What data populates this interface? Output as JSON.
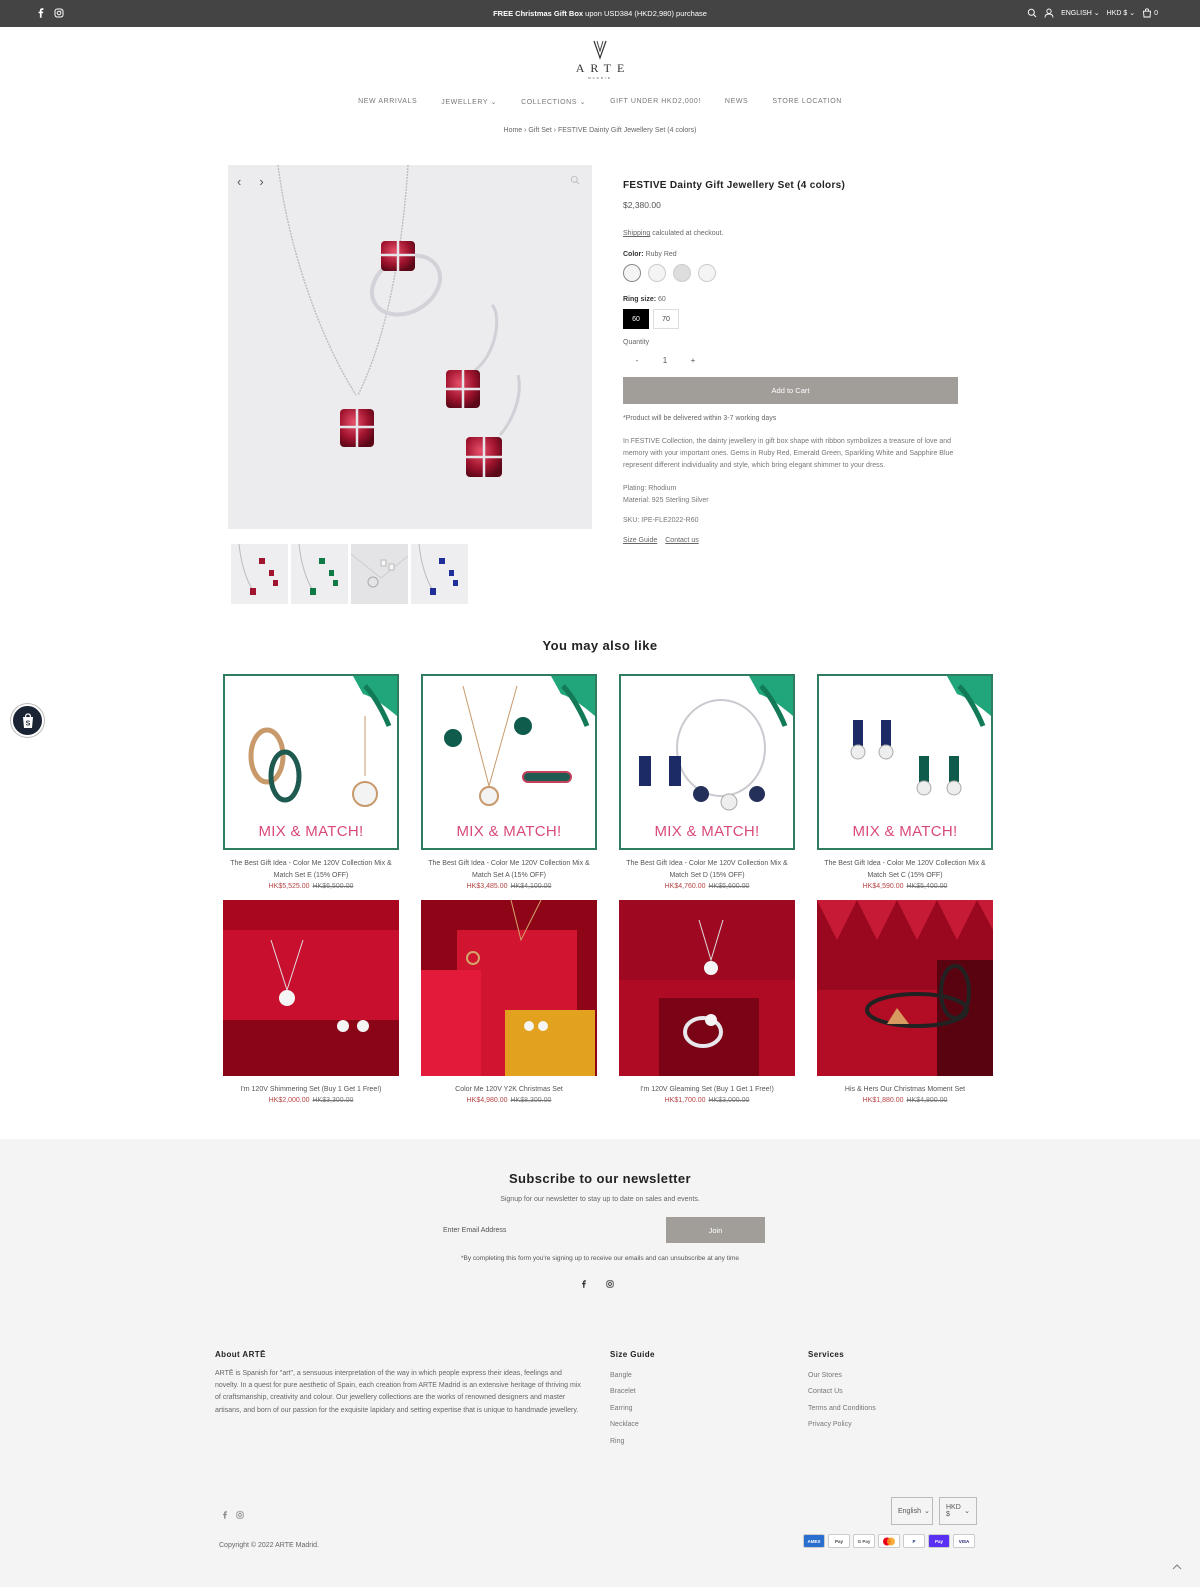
{
  "announcement": {
    "bold": "FREE Christmas Gift Box",
    "rest": " upon USD384 (HKD2,980) purchase",
    "social": [
      "facebook-icon",
      "instagram-icon"
    ]
  },
  "tools": {
    "language": "ENGLISH",
    "currency": "HKD $",
    "cart_count": "0"
  },
  "brand": {
    "word": "ARTE",
    "sub": "MADRID"
  },
  "nav": [
    "NEW ARRIVALS",
    "JEWELLERY",
    "COLLECTIONS",
    "GIFT UNDER HKD2,000!",
    "NEWS",
    "STORE LOCATION"
  ],
  "breadcrumb": "Home › Gift Set › FESTIVE Dainty Gift Jewellery Set (4 colors)",
  "product": {
    "title": "FESTIVE Dainty Gift Jewellery Set (4 colors)",
    "price": "$2,380.00",
    "shipping_link": "Shipping",
    "shipping_rest": " calculated at checkout.",
    "color_label": "Color:",
    "color_value": "Ruby Red",
    "ring_label": "Ring size:",
    "ring_value": "60",
    "sizes": [
      "60",
      "70"
    ],
    "quantity_label": "Quantity",
    "qty_minus": "-",
    "qty_value": "1",
    "qty_plus": "+",
    "add_to_cart": "Add to Cart",
    "delivery_note": "*Product will be delivered within 3-7 working days",
    "description": "In FESTIVE Collection, the dainty jewellery in gift box shape with ribbon symbolizes a treasure of love and memory with your important ones. Gems in Ruby Red, Emerald Green, Sparkling White and Sapphire Blue represent different individuality and style, which bring elegant shimmer to your dress.",
    "plating": "Plating: Rhodium",
    "material": "Material: 925 Sterling Silver",
    "sku": "SKU: IPE-FLE2022-R60",
    "size_guide": "Size Guide",
    "contact": "Contact us",
    "gallery_prev": "‹",
    "gallery_next": "›"
  },
  "related": {
    "title": "You may also like",
    "mix_text": "MIX & MATCH!",
    "items": [
      {
        "title": "The Best Gift Idea - Color Me 120V Collection Mix & Match Set E (15% OFF)",
        "sale": "HK$5,525.00",
        "was": "HK$6,500.00"
      },
      {
        "title": "The Best Gift Idea - Color Me 120V Collection Mix & Match Set A (15% OFF)",
        "sale": "HK$3,485.00",
        "was": "HK$4,100.00"
      },
      {
        "title": "The Best Gift Idea - Color Me 120V Collection Mix & Match Set D (15% OFF)",
        "sale": "HK$4,760.00",
        "was": "HK$5,600.00"
      },
      {
        "title": "The Best Gift Idea - Color Me 120V Collection Mix & Match Set C (15% OFF)",
        "sale": "HK$4,590.00",
        "was": "HK$5,400.00"
      },
      {
        "title": "I'm 120V Shimmering Set (Buy 1 Get 1 Free!)",
        "sale": "HK$2,000.00",
        "was": "HK$3,300.00"
      },
      {
        "title": "Color Me 120V Y2K Christmas Set",
        "sale": "HK$4,980.00",
        "was": "HK$8,300.00"
      },
      {
        "title": "I'm 120V Gleaming Set (Buy 1 Get 1 Free!)",
        "sale": "HK$1,700.00",
        "was": "HK$3,000.00"
      },
      {
        "title": "His & Hers Our Christmas Moment Set",
        "sale": "HK$1,880.00",
        "was": "HK$4,800.00"
      }
    ]
  },
  "newsletter": {
    "title": "Subscribe to our newsletter",
    "subtitle": "Signup for our newsletter to stay up to date on sales and events.",
    "placeholder": "Enter Email Address",
    "join": "Join",
    "note": "*By completing this form you're signing up to receive our emails and can unsubscribe at any time"
  },
  "footer": {
    "about_title": "About ARTĒ",
    "about_text": "ARTĒ is Spanish for \"art\", a sensuous interpretation of the way in which people express their ideas, feelings and novelty. In a quest for pure aesthetic of Spain, each creation from ARTE Madrid is an extensive heritage of thriving mix of craftsmanship, creativity and colour. Our jewellery collections are the works of renowned designers and master artisans, and born of our passion for the exquisite lapidary and setting expertise that is unique to handmade jewellery.",
    "size_title": "Size Guide",
    "size_links": [
      "Bangle",
      "Bracelet",
      "Earring",
      "Necklace",
      "Ring"
    ],
    "services_title": "Services",
    "services_links": [
      "Our Stores",
      "Contact Us",
      "Terms and Conditions",
      "Privacy Policy"
    ],
    "language": "English",
    "currency": "HKD $",
    "copyright": "Copyright © 2022 ARTE Madrid.",
    "payments": [
      "AMEX",
      "Pay",
      "G Pay",
      "",
      "P",
      "Pay",
      "VISA"
    ]
  },
  "colors": {
    "topbar": "#444444",
    "button": "#a19e9a",
    "sale": "#b54444",
    "green_frame": "#2e7d5e",
    "gift_red": "#c8102e"
  }
}
